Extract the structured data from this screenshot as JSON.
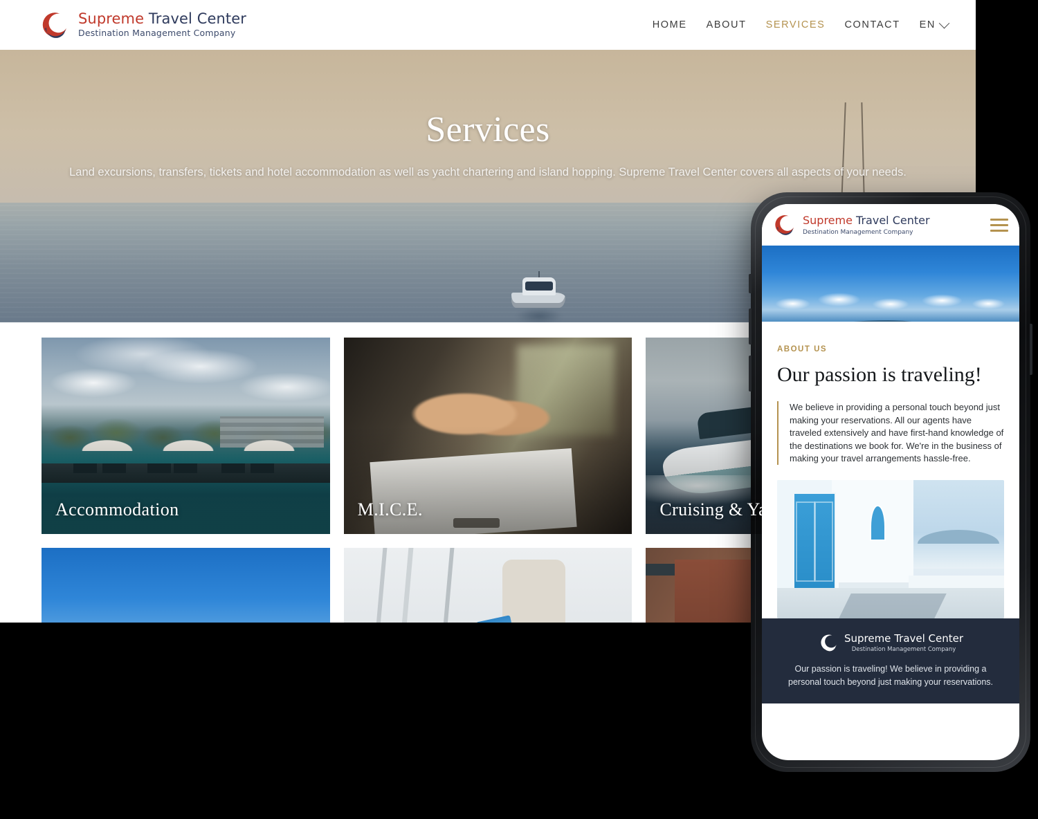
{
  "brand": {
    "name_part1": "Supreme",
    "name_part2": " Travel Center",
    "tagline": "Destination Management Company",
    "logo_icon": "crescent-swoosh-logo",
    "color_red": "#c0392b",
    "color_navy": "#2e3a5c",
    "accent_gold": "#b4924f"
  },
  "desktop": {
    "nav": {
      "items": [
        {
          "label": "HOME",
          "active": false
        },
        {
          "label": "ABOUT",
          "active": false
        },
        {
          "label": "SERVICES",
          "active": true
        },
        {
          "label": "CONTACT",
          "active": false
        }
      ],
      "language": {
        "label": "EN",
        "icon": "chevron-down-icon"
      }
    },
    "hero": {
      "title": "Services",
      "subtitle": "Land excursions, transfers, tickets and hotel accommodation as well as yacht chartering and island hopping. Supreme Travel Center covers all aspects of your needs.",
      "image_alt": "boat-at-sea-sunset"
    },
    "services": [
      {
        "label": "Accommodation",
        "image_alt": "resort-pool-with-umbrellas"
      },
      {
        "label": "M.I.C.E.",
        "image_alt": "business-handshake-over-documents"
      },
      {
        "label": "Cruising & Ya",
        "image_alt": "luxury-yacht-at-sea"
      },
      {
        "label": "",
        "image_alt": "santorini-blue-sky-caldera"
      },
      {
        "label": "",
        "image_alt": "traveler-at-airport-with-boarding-pass"
      },
      {
        "label": "",
        "image_alt": "friends-smiling-on-excursion"
      }
    ]
  },
  "phone": {
    "nav": {
      "menu_icon": "hamburger-menu-icon"
    },
    "hero": {
      "image_alt": "santorini-caldera-blue-dome"
    },
    "about": {
      "eyebrow": "ABOUT US",
      "title": "Our passion is traveling!",
      "quote": "We believe in providing a personal touch beyond just making your reservations. All our agents have traveled extensively and have first-hand knowledge of the destinations we book for. We're in the business of making your travel arrangements hassle-free.",
      "image_alt": "blue-door-white-wall-santorini"
    },
    "footer": {
      "text": "Our passion is traveling! We believe in providing a personal touch beyond just making your reservations.",
      "background": "#232c3d"
    }
  }
}
